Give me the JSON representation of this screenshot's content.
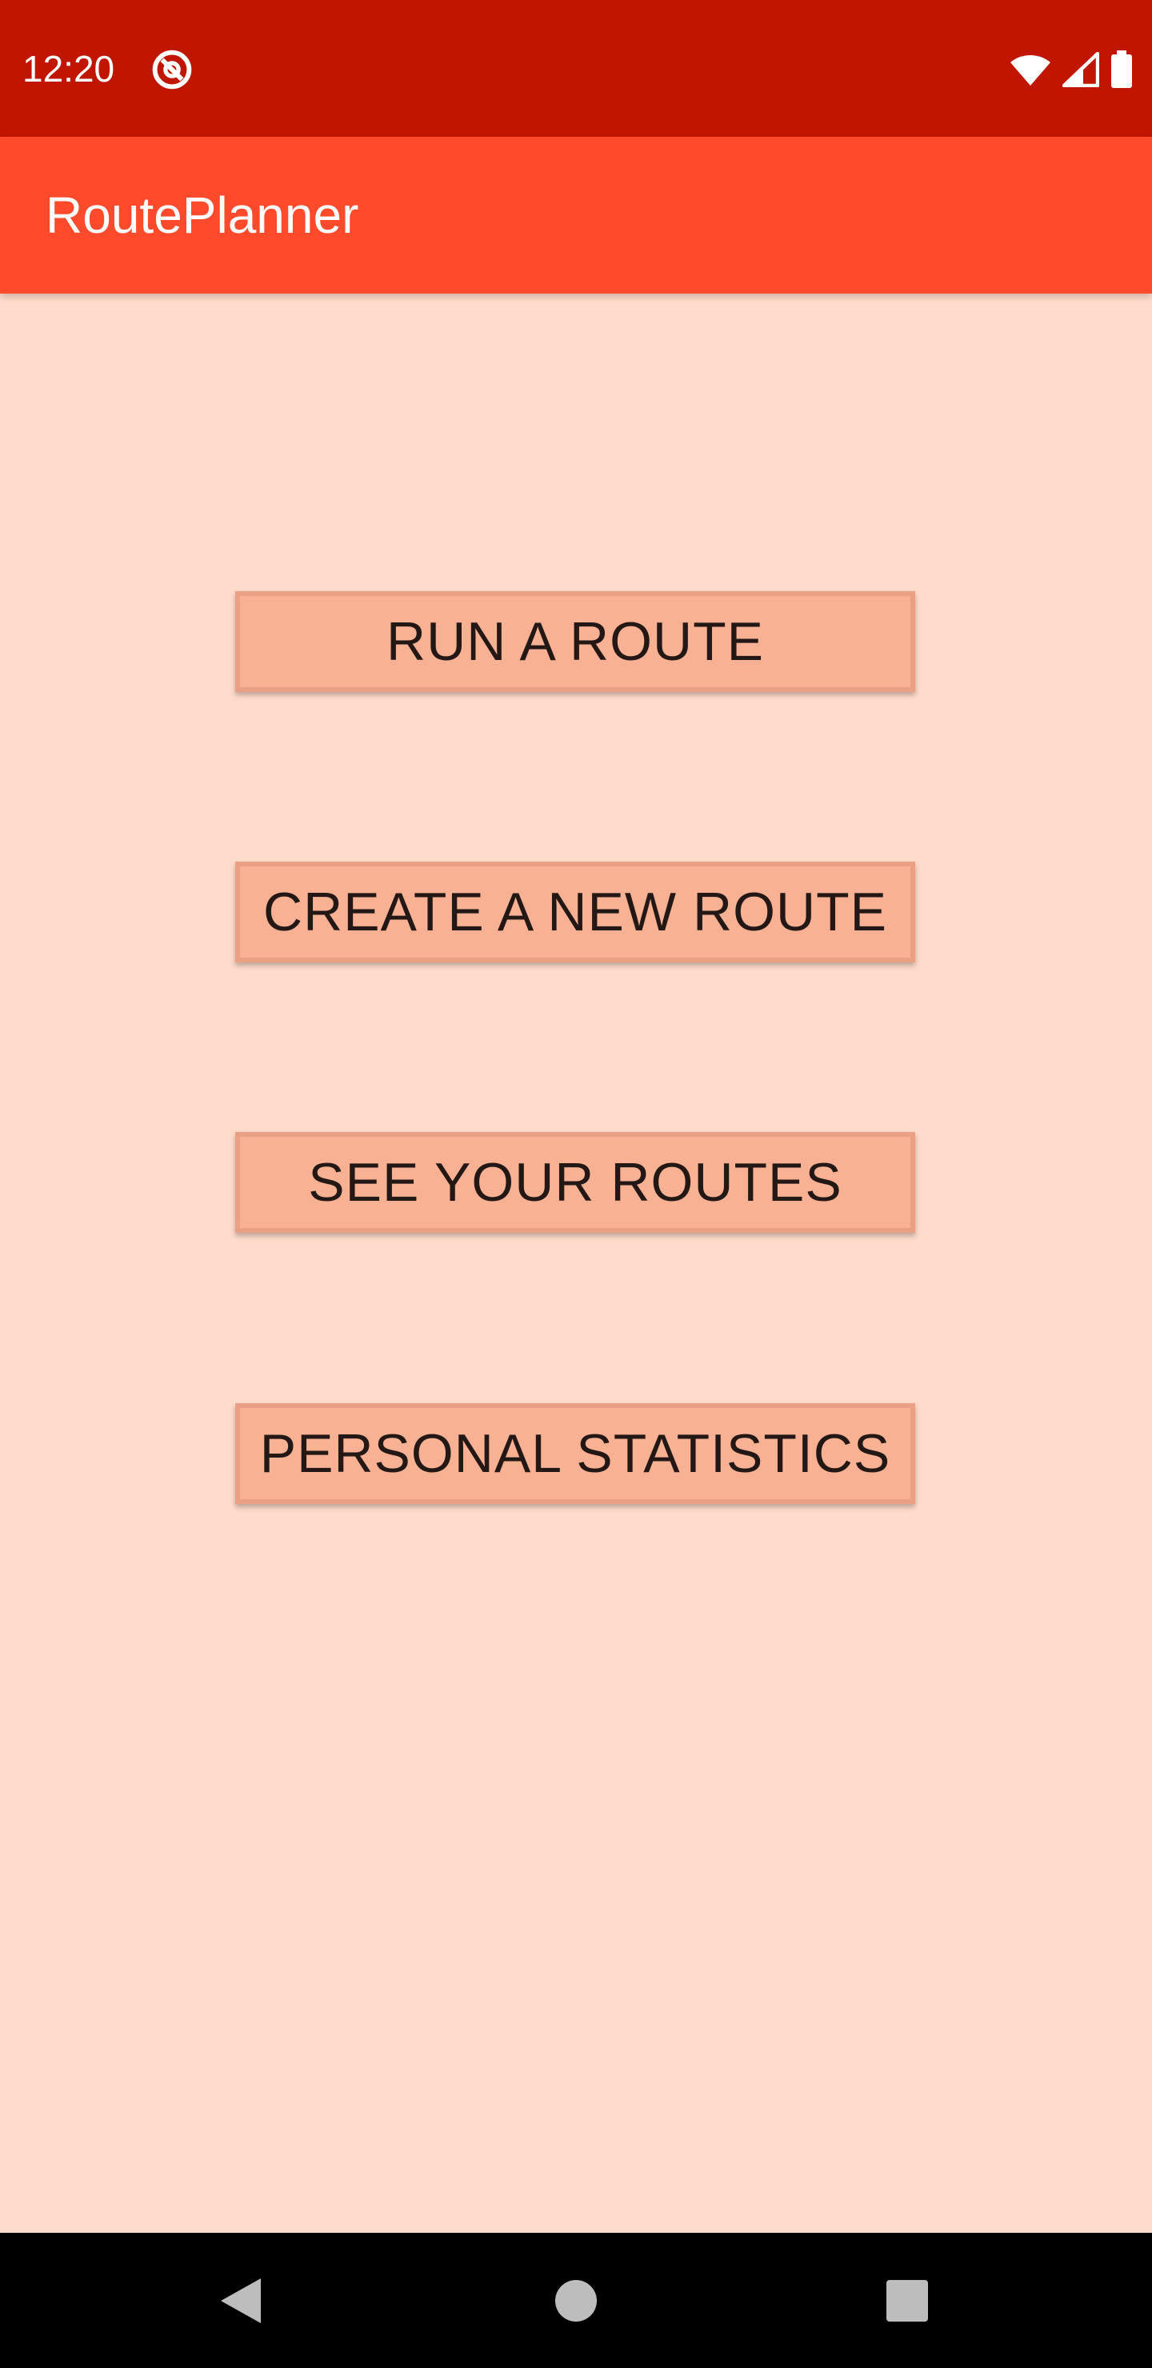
{
  "status_bar": {
    "time": "12:20",
    "icons": [
      "at-sign-icon",
      "wifi-icon",
      "cell-signal-icon",
      "battery-icon"
    ],
    "color": "#C01600"
  },
  "app_bar": {
    "title": "RoutePlanner",
    "color": "#FF4A2B"
  },
  "menu": {
    "buttons": [
      {
        "label": "RUN A ROUTE"
      },
      {
        "label": "CREATE A NEW ROUTE"
      },
      {
        "label": "SEE YOUR ROUTES"
      },
      {
        "label": "PERSONAL STATISTICS"
      }
    ],
    "button_color": "#F9B193",
    "background_color": "#FEDBCA"
  },
  "nav_bar": {
    "icons": [
      "back-icon",
      "home-icon",
      "recents-icon"
    ]
  }
}
